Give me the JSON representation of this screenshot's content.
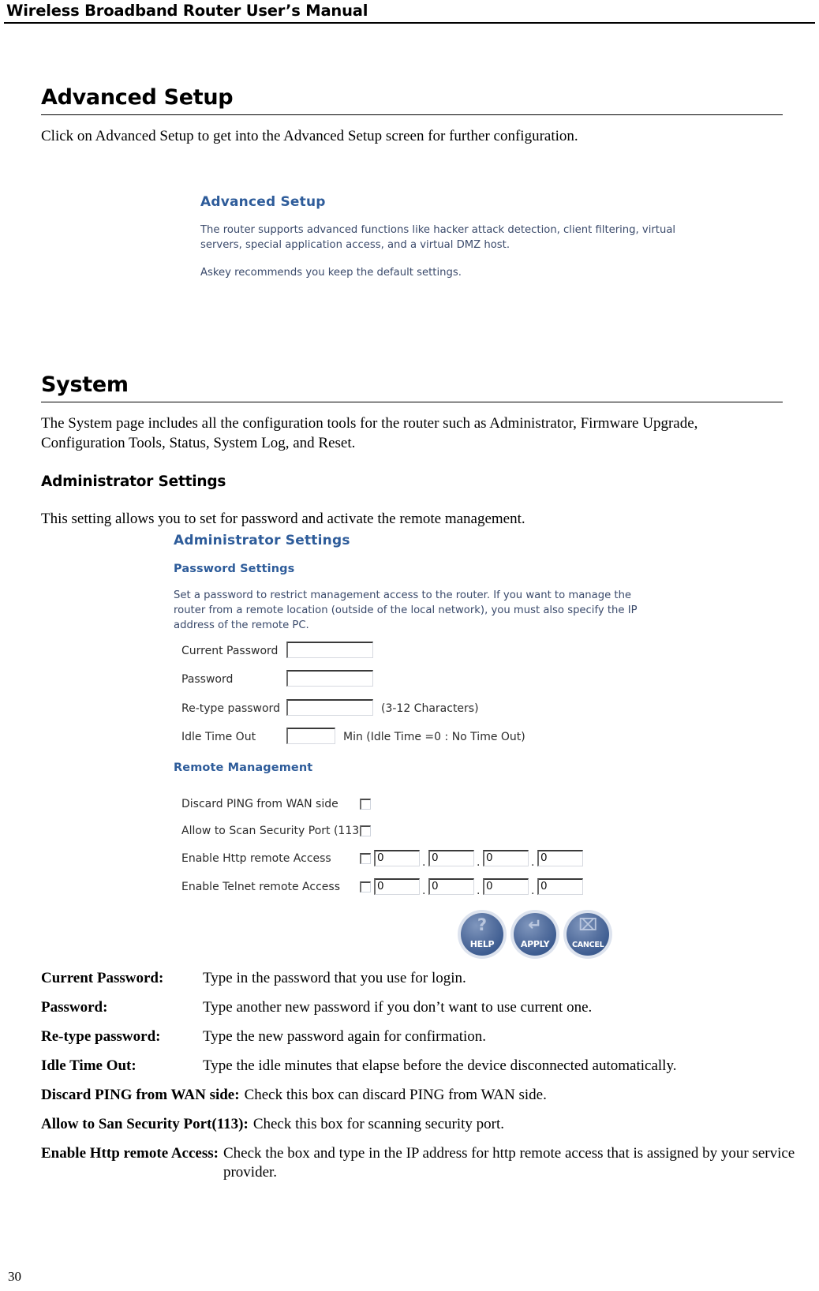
{
  "header": {
    "title": "Wireless Broadband Router User’s Manual"
  },
  "sections": {
    "advanced_setup": {
      "heading": "Advanced Setup",
      "intro": "Click on Advanced Setup to get into the Advanced Setup screen for further configuration.",
      "screenshot": {
        "title": "Advanced Setup",
        "paragraph": "The router supports advanced functions like hacker attack detection, client filtering, virtual servers, special application access, and a virtual DMZ host.",
        "recommendation": "Askey recommends you keep the default settings."
      }
    },
    "system": {
      "heading": "System",
      "intro": "The System page includes all the configuration tools for the router such as Administrator, Firmware Upgrade, Configuration Tools, Status, System Log, and Reset.",
      "subheading": "Administrator Settings",
      "sub_intro": "This setting allows you to set for password and activate the remote management."
    }
  },
  "admin_screenshot": {
    "title": "Administrator Settings",
    "password_section": {
      "heading": "Password Settings",
      "description": "Set a password to restrict management access to the router. If you want to manage the router from a remote location (outside of the local network), you must also specify the IP address of the remote PC.",
      "fields": [
        {
          "label": "Current Password",
          "value": "",
          "note": ""
        },
        {
          "label": "Password",
          "value": "",
          "note": ""
        },
        {
          "label": "Re-type password",
          "value": "",
          "note": "(3-12 Characters)"
        },
        {
          "label": "Idle Time Out",
          "value": "",
          "note": "Min (Idle Time =0 : No Time Out)"
        }
      ]
    },
    "remote_section": {
      "heading": "Remote Management",
      "rows": [
        {
          "label": "Discard PING from WAN side",
          "checked": false,
          "ip": null
        },
        {
          "label": "Allow to Scan Security Port (113)",
          "checked": false,
          "ip": null
        },
        {
          "label": "Enable Http remote Access",
          "checked": false,
          "ip": [
            "0",
            "0",
            "0",
            "0"
          ]
        },
        {
          "label": "Enable Telnet remote Access",
          "checked": false,
          "ip": [
            "0",
            "0",
            "0",
            "0"
          ]
        }
      ]
    },
    "buttons": [
      {
        "label": "HELP",
        "glyph": "?",
        "icon": "help-icon"
      },
      {
        "label": "APPLY",
        "glyph": "↵",
        "icon": "apply-icon"
      },
      {
        "label": "CANCEL",
        "glyph": "⌧",
        "icon": "cancel-icon"
      }
    ]
  },
  "definitions": [
    {
      "term": "Current Password:",
      "desc": "Type in the password that you use for login.",
      "style": "tabbed"
    },
    {
      "term": "Password:",
      "desc": "Type another new password if you don’t want to use current one.",
      "style": "tabbed"
    },
    {
      "term": "Re-type password:",
      "desc": "Type the new password again for confirmation.",
      "style": "tabbed"
    },
    {
      "term": "Idle Time Out:",
      "desc": "Type the idle minutes that elapse before the device disconnected automatically.",
      "style": "tabbed"
    },
    {
      "term": "Discard PING from WAN side:",
      "desc": "Check this box can discard PING from WAN side.",
      "style": "inline"
    },
    {
      "term": "Allow to San Security Port(113):",
      "desc": "Check this box for scanning security port.",
      "style": "inline"
    },
    {
      "term": "Enable Http remote Access:",
      "desc": "Check the box and type in the IP address for http remote access that is assigned by your service provider.",
      "style": "inline"
    }
  ],
  "footer": {
    "page_number": "30"
  },
  "colors": {
    "ui_heading_blue": "#2E5C9A",
    "ui_body_blue": "#3A4A6B",
    "button_blue": "#3E5D91"
  }
}
